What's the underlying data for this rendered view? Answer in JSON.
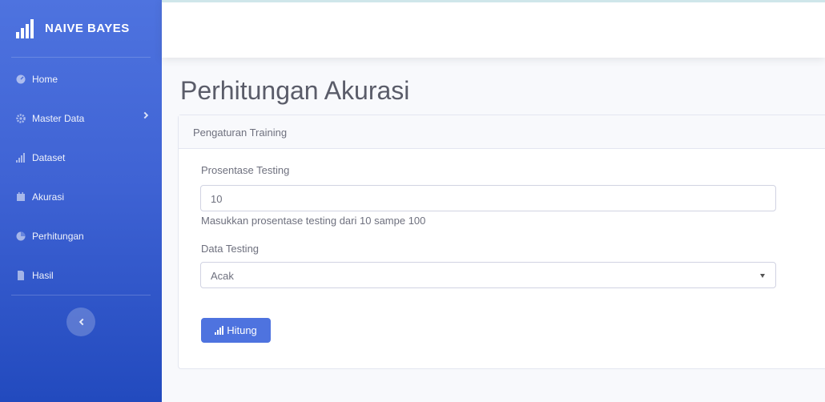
{
  "brand": {
    "name": "NAIVE BAYES",
    "icon": "signal-bars-icon"
  },
  "sidebar": {
    "items": [
      {
        "label": "Home",
        "icon": "dashboard-icon"
      },
      {
        "label": "Master Data",
        "icon": "cog-icon",
        "has_submenu": true
      },
      {
        "label": "Dataset",
        "icon": "signal-bars-icon"
      },
      {
        "label": "Akurasi",
        "icon": "calendar-icon"
      },
      {
        "label": "Perhitungan",
        "icon": "chart-pie-icon"
      },
      {
        "label": "Hasil",
        "icon": "file-icon"
      }
    ],
    "toggle_icon": "chevron-left-icon"
  },
  "page": {
    "title": "Perhitungan Akurasi"
  },
  "card": {
    "header": "Pengaturan Training",
    "testing_label": "Prosentase Testing",
    "testing_value": "10",
    "testing_help": "Masukkan prosentase testing dari 10 sampe 100",
    "data_testing_label": "Data Testing",
    "data_testing_value": "Acak",
    "submit_label": "Hitung"
  },
  "colors": {
    "sidebar_primary": "#4e73df",
    "sidebar_dark": "#224abe",
    "button": "#4e73df"
  }
}
